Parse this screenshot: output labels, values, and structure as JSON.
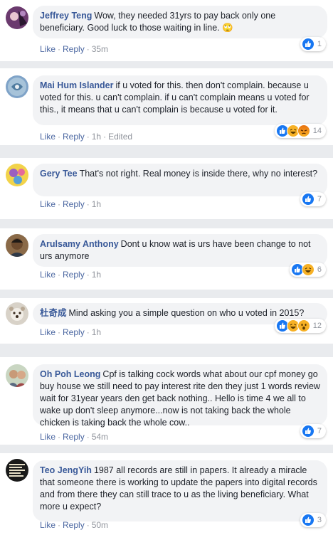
{
  "actions": {
    "like": "Like",
    "reply": "Reply",
    "dot": "·",
    "edited": "Edited"
  },
  "comments": [
    {
      "author": "Jeffrey Teng",
      "text": "Wow, they needed 31yrs to pay back only one beneficiary. Good luck to those waiting in line. 🙄",
      "time": "35m",
      "reaction_count": "1",
      "reactions": [
        "like-icon"
      ]
    },
    {
      "author": "Mai Hum Islander",
      "text": "if u voted for this. then don't complain. because u voted for this. u can't complain. if u can't complain means u voted for this., it means that u can't complain is because u voted for it.",
      "time": "1h",
      "reaction_count": "14",
      "reactions": [
        "like-icon",
        "haha-icon",
        "angry-icon"
      ]
    },
    {
      "author": "Gery Tee",
      "text": "That's not right. Real money is inside there, why no interest?",
      "time": "1h",
      "reaction_count": "7",
      "reactions": [
        "like-icon"
      ]
    },
    {
      "author": "Arulsamy Anthony",
      "text": "Dont u know wat is urs have been change to not urs anymore",
      "time": "1h",
      "reaction_count": "6",
      "reactions": [
        "like-icon",
        "haha-icon"
      ]
    },
    {
      "author": "杜奇成",
      "text": "Mind asking you a simple question on who u voted in 2015?",
      "time": "1h",
      "reaction_count": "12",
      "reactions": [
        "like-icon",
        "haha-icon",
        "wow-icon"
      ]
    },
    {
      "author": "Oh Poh Leong",
      "text": "Cpf is talking cock words what about our cpf money go buy house we still need to pay interest rite den they just 1 words review wait for 31year years den get back nothing.. Hello is time 4 we all to wake up don't sleep anymore...now is not taking back the whole chicken is taking back the whole cow..",
      "time": "54m",
      "reaction_count": "7",
      "reactions": [
        "like-icon"
      ]
    },
    {
      "author": "Teo JengYih",
      "text": "1987 all records are still in papers. It already a miracle that someone there is working to update the papers into digital records and from there they can still trace to u as the living beneficiary. What more u expect?",
      "time": "50m",
      "reaction_count": "3",
      "reactions": [
        "like-icon"
      ]
    }
  ],
  "colors": {
    "author": "#385898",
    "like": "#1877f2",
    "haha": "#f7b125",
    "angry": "#e9710f",
    "background": "#e9ebee"
  }
}
